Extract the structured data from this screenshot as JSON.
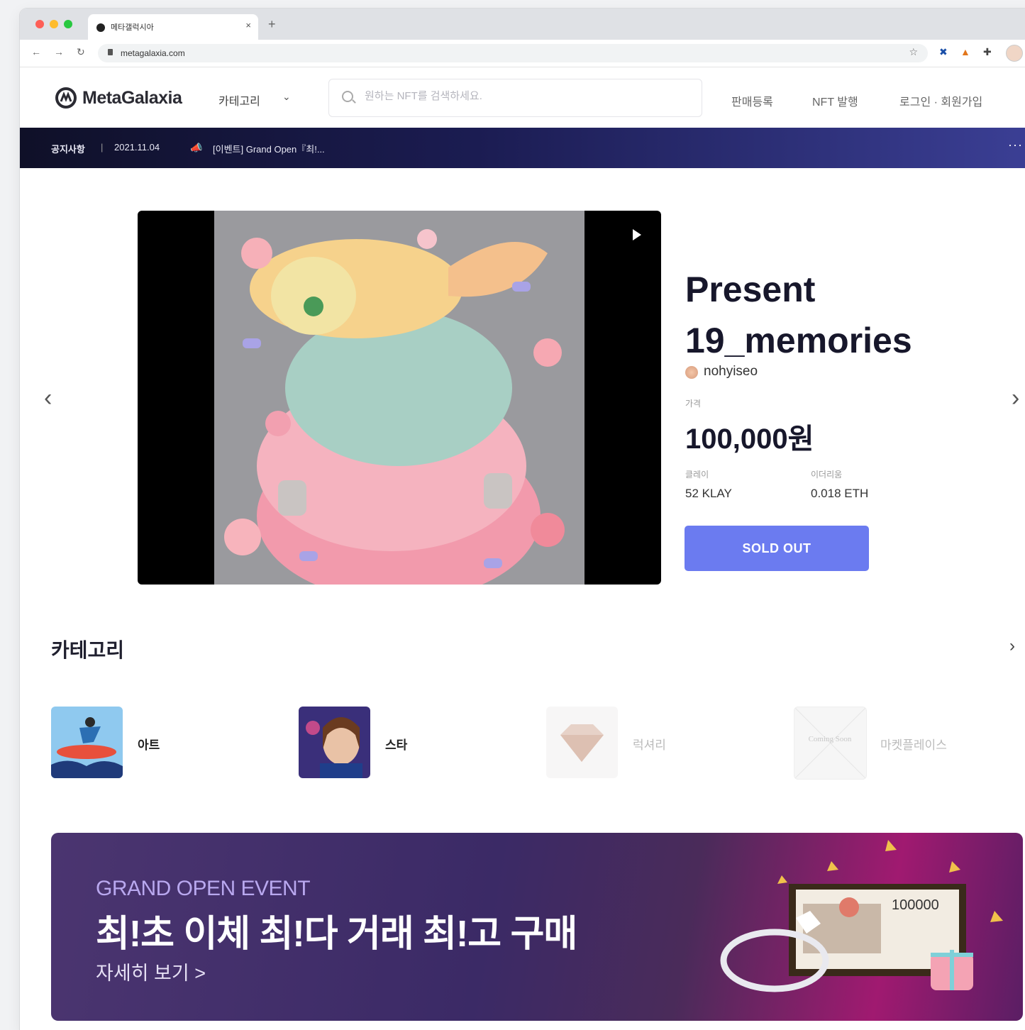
{
  "browser": {
    "tab_title": "메타갤럭시아",
    "url": "metagalaxia.com",
    "tab_close": "×",
    "new_tab": "+"
  },
  "header": {
    "logo_text": "MetaGalaxia",
    "category_menu": "카테고리",
    "search_placeholder": "원하는 NFT를 검색하세요.",
    "nav": [
      "판매등록",
      "NFT 발행",
      "로그인 · 회원가입"
    ]
  },
  "notice": {
    "label": "공지사항",
    "date": "2021.11.04",
    "text": "[이벤트] Grand Open『최!..."
  },
  "hero": {
    "title_line1": "Present",
    "title_line2": "19_memories",
    "creator": "nohyiseo",
    "price_label": "가격",
    "price": "100,000원",
    "klay_label": "클레이",
    "klay_value": "52 KLAY",
    "eth_label": "이더리움",
    "eth_value": "0.018 ETH",
    "button": "SOLD OUT"
  },
  "categories": {
    "title": "카테고리",
    "items": [
      {
        "label": "아트",
        "enabled": true
      },
      {
        "label": "스타",
        "enabled": true
      },
      {
        "label": "럭셔리",
        "enabled": false
      },
      {
        "label": "마켓플레이스",
        "enabled": false,
        "thumb_text": "Coming Soon"
      }
    ]
  },
  "banner": {
    "subtitle": "GRAND OPEN EVENT",
    "title": "최!초 이체 최!다 거래 최!고 구매",
    "link": "자세히 보기 >",
    "note_value": "100000"
  },
  "colors": {
    "accent": "#6b7bf0",
    "notice_bg": "#1b1c52",
    "banner_bg": "#3b2a66"
  }
}
